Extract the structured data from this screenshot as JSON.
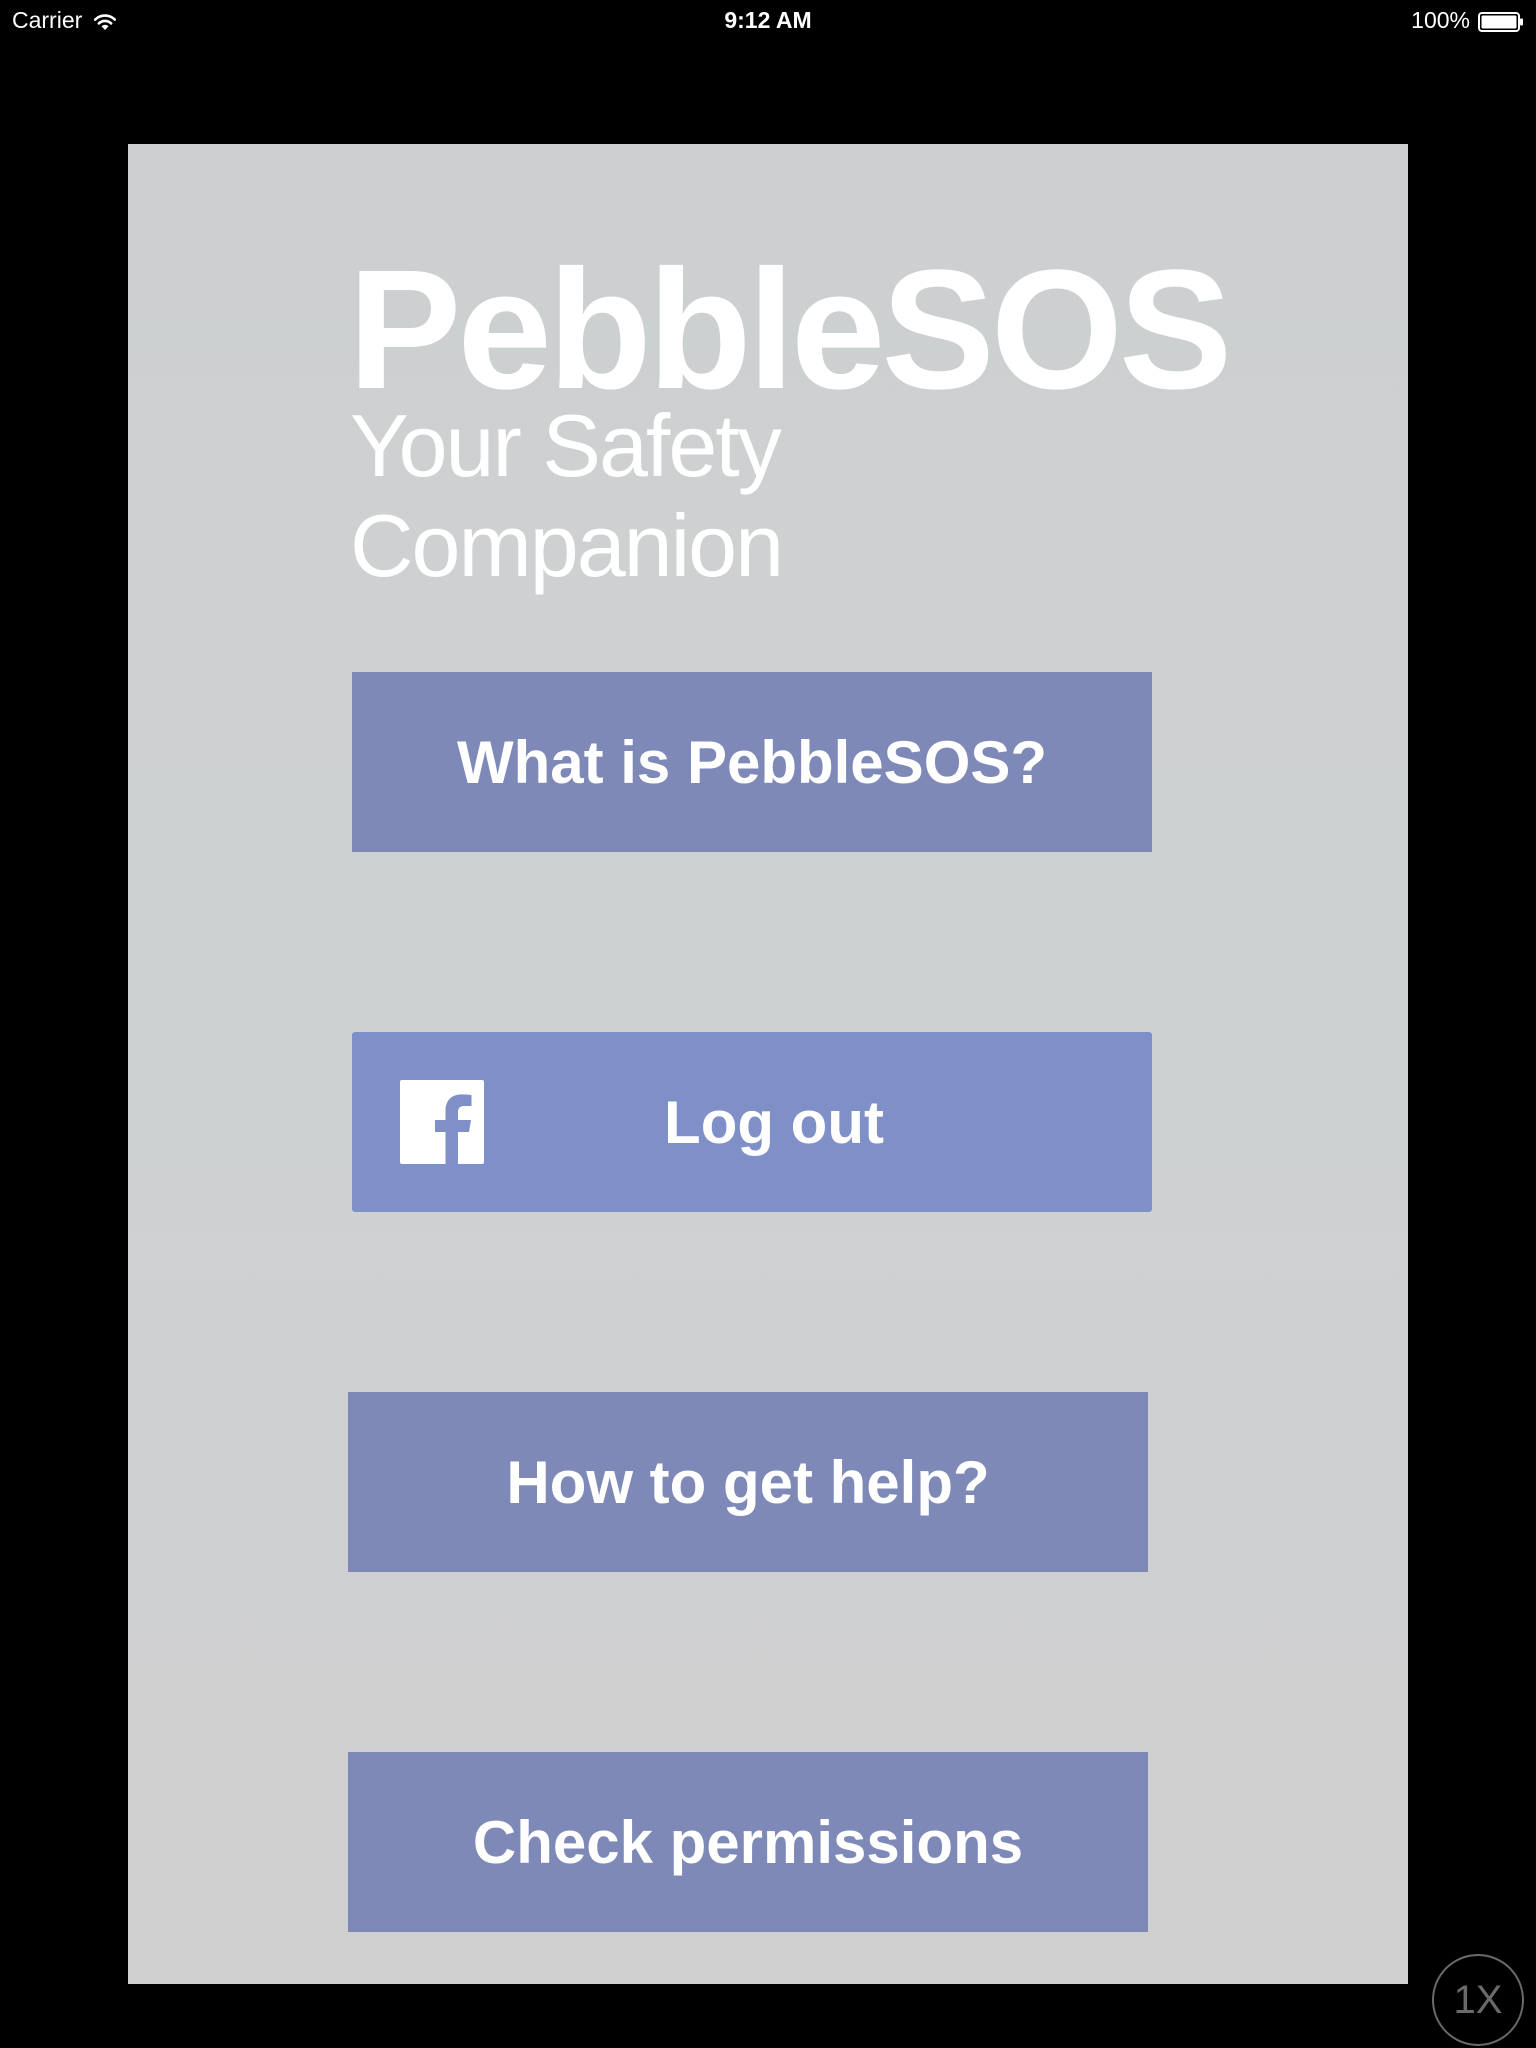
{
  "status_bar": {
    "carrier": "Carrier",
    "wifi_icon": "wifi-icon",
    "time": "9:12 AM",
    "battery_percent": "100%",
    "battery_icon": "battery-icon",
    "battery_level": 1.0
  },
  "app": {
    "title": "PebbleSOS",
    "subtitle": "Your Safety Companion",
    "background_color": "#cdcfd0",
    "button_color": "#7e89b8",
    "facebook_button_color": "#7f90c8",
    "text_color": "#ffffff"
  },
  "menu": {
    "what_is_label": "What is PebbleSOS?",
    "logout_label": "Log out",
    "logout_icon": "facebook-icon",
    "help_label": "How to get help?",
    "permissions_label": "Check permissions"
  },
  "zoom_indicator": {
    "label": "1X"
  }
}
